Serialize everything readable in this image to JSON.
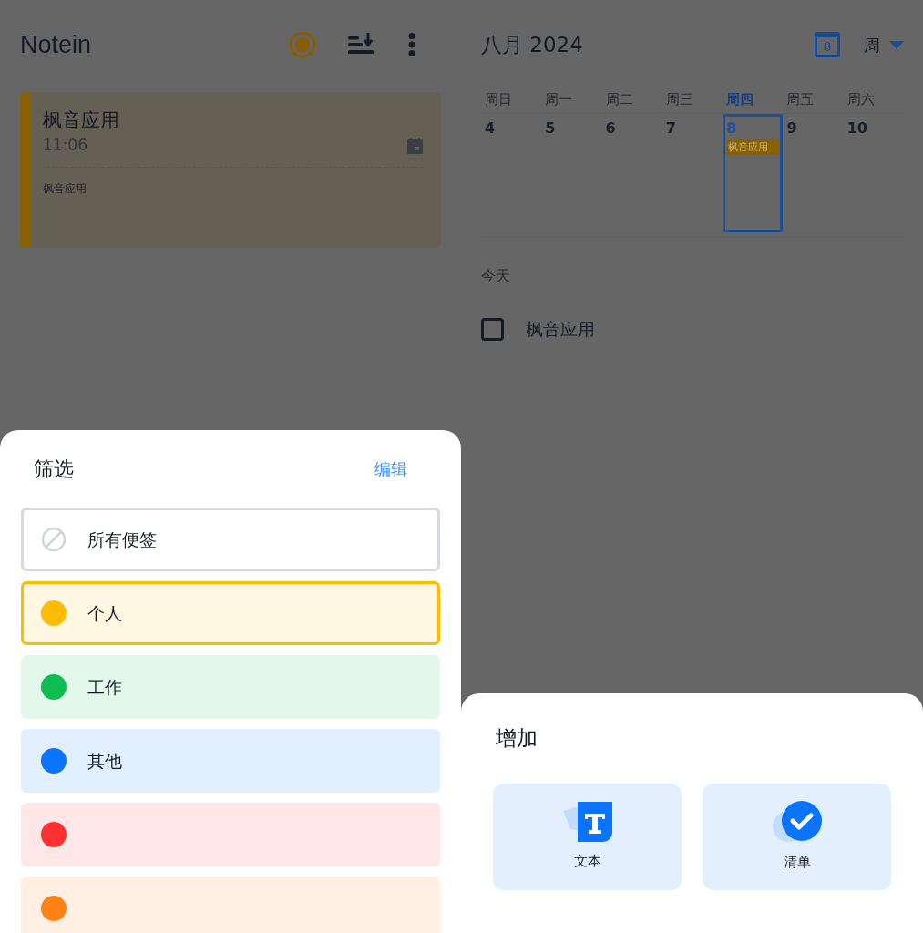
{
  "notes_panel": {
    "app_title": "Notein",
    "note_card": {
      "title": "枫音应用",
      "time": "11:06",
      "body": "枫音应用",
      "color": "#8a6100"
    }
  },
  "calendar_panel": {
    "month_title": "八月 2024",
    "today_badge": "8",
    "view_selector": "周",
    "weekdays": [
      {
        "label": "周日",
        "selected": false
      },
      {
        "label": "周一",
        "selected": false
      },
      {
        "label": "周二",
        "selected": false
      },
      {
        "label": "周三",
        "selected": false
      },
      {
        "label": "周四",
        "selected": true
      },
      {
        "label": "周五",
        "selected": false
      },
      {
        "label": "周六",
        "selected": false
      }
    ],
    "days": [
      {
        "date": "4",
        "selected": false
      },
      {
        "date": "5",
        "selected": false
      },
      {
        "date": "6",
        "selected": false
      },
      {
        "date": "7",
        "selected": false
      },
      {
        "date": "8",
        "selected": true,
        "events": [
          "枫音应用"
        ]
      },
      {
        "date": "9",
        "selected": false
      },
      {
        "date": "10",
        "selected": false
      }
    ],
    "today_label": "今天",
    "today_tasks": [
      {
        "title": "枫音应用",
        "checked": false
      }
    ]
  },
  "filter_sheet": {
    "title": "筛选",
    "edit_link": "编辑",
    "filters": [
      {
        "kind": "all",
        "label": "所有便签",
        "selected": false
      },
      {
        "kind": "color",
        "label": "个人",
        "color": "#ffbb00",
        "selected": true
      },
      {
        "kind": "color",
        "label": "工作",
        "color": "#0dbd52",
        "selected": false
      },
      {
        "kind": "color",
        "label": "其他",
        "color": "#0a74ff",
        "selected": false
      },
      {
        "kind": "color",
        "color": "#ff3030",
        "selected": false
      },
      {
        "kind": "color",
        "color": "#ff8214",
        "selected": false
      }
    ]
  },
  "add_sheet": {
    "title": "增加",
    "options": [
      {
        "kind": "text",
        "label": "文本"
      },
      {
        "kind": "checklist",
        "label": "清单"
      }
    ]
  }
}
